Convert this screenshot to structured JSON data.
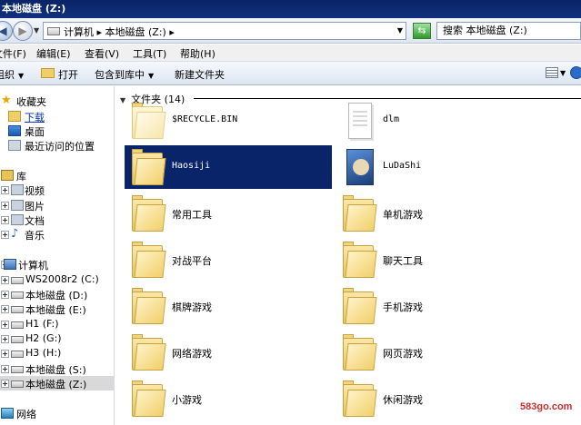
{
  "window": {
    "title": "本地磁盘 (Z:)"
  },
  "address": {
    "path": "计算机 ▸ 本地磁盘 (Z:) ▸",
    "search_placeholder": "搜索 本地磁盘 (Z:)"
  },
  "menu": [
    "文件(F)",
    "编辑(E)",
    "查看(V)",
    "工具(T)",
    "帮助(H)"
  ],
  "toolbar": {
    "organize": "组织",
    "open": "打开",
    "include": "包含到库中",
    "new_folder": "新建文件夹"
  },
  "nav": {
    "favorites": "收藏夹",
    "downloads": "下载",
    "desktop": "桌面",
    "recent": "最近访问的位置",
    "libraries": "库",
    "videos": "视频",
    "pictures": "图片",
    "documents": "文档",
    "music": "音乐",
    "computer": "计算机",
    "drives": [
      "WS2008r2 (C:)",
      "本地磁盘 (D:)",
      "本地磁盘 (E:)",
      "H1 (F:)",
      "H2 (G:)",
      "H3 (H:)",
      "本地磁盘 (S:)",
      "本地磁盘 (Z:)"
    ],
    "network": "网络"
  },
  "content": {
    "group_label": "文件夹 (14)",
    "items": [
      {
        "name": "$RECYCLE.BIN",
        "icon": "recycle-folder-icon"
      },
      {
        "name": "dlm",
        "icon": "document-icon"
      },
      {
        "name": "Haosiji",
        "icon": "folder-icon",
        "selected": true
      },
      {
        "name": "LuDaShi",
        "icon": "image-icon"
      },
      {
        "name": "常用工具",
        "icon": "folder-icon"
      },
      {
        "name": "单机游戏",
        "icon": "folder-icon"
      },
      {
        "name": "对战平台",
        "icon": "folder-icon"
      },
      {
        "name": "聊天工具",
        "icon": "folder-icon"
      },
      {
        "name": "棋牌游戏",
        "icon": "folder-icon"
      },
      {
        "name": "手机游戏",
        "icon": "folder-icon"
      },
      {
        "name": "网络游戏",
        "icon": "folder-icon"
      },
      {
        "name": "网页游戏",
        "icon": "folder-icon"
      },
      {
        "name": "小游戏",
        "icon": "folder-icon"
      },
      {
        "name": "休闲游戏",
        "icon": "folder-icon"
      }
    ]
  },
  "watermark": "583go.com",
  "colors": {
    "selection": "#0a246a",
    "titlebar": "#0a2466"
  }
}
